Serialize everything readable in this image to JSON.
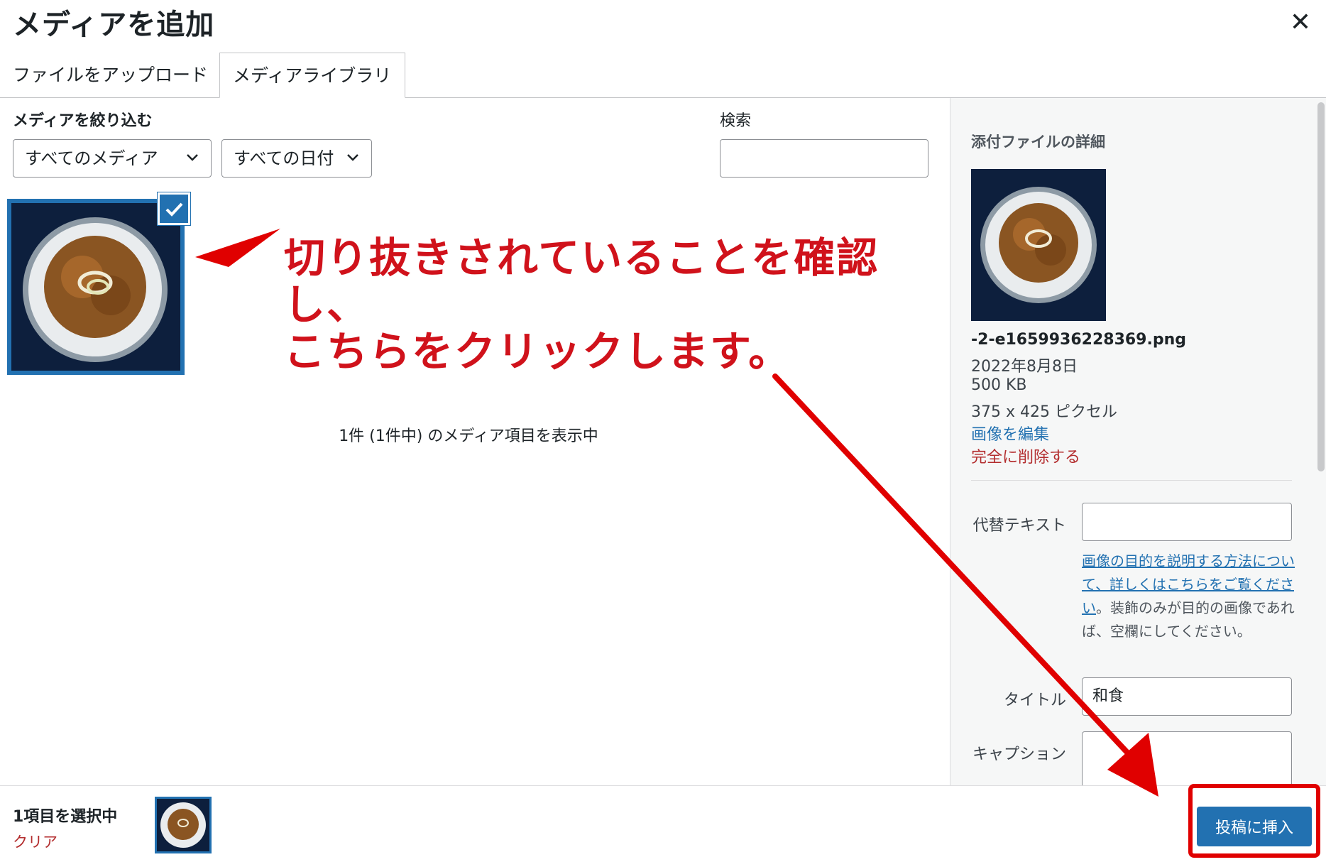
{
  "dialog": {
    "title": "メディアを追加",
    "close_icon": "close-icon"
  },
  "tabs": [
    {
      "label": "ファイルをアップロード",
      "active": false
    },
    {
      "label": "メディアライブラリ",
      "active": true
    }
  ],
  "toolbar": {
    "filter_label": "メディアを絞り込む",
    "media_type_selected": "すべてのメディア",
    "date_selected": "すべての日付",
    "search_label": "検索",
    "search_value": ""
  },
  "grid": {
    "items": [
      {
        "description": "natto rice bowl",
        "selected": true
      }
    ],
    "count_text": "1件 (1件中) のメディア項目を表示中"
  },
  "annotation": {
    "line1": "切り抜きされていることを確認し、",
    "line2": "こちらをクリックします。",
    "color": "#d0121b"
  },
  "attachment_details": {
    "heading": "添付ファイルの詳細",
    "filename": "-2-e1659936228369.png",
    "date": "2022年8月8日",
    "size": "500 KB",
    "dimensions": "375 x 425 ピクセル",
    "edit_link": "画像を編集",
    "delete_link": "完全に削除する",
    "alt_label": "代替テキスト",
    "alt_value": "",
    "alt_help_link": "画像の目的を説明する方法について、詳しくはこちらをご覧ください",
    "alt_help_text": "。装飾のみが目的の画像であれば、空欄にしてください。",
    "title_label": "タイトル",
    "title_value": "和食",
    "caption_label": "キャプション",
    "caption_value": ""
  },
  "footer": {
    "selected_count": "1項目を選択中",
    "clear_link": "クリア",
    "insert_button": "投稿に挿入"
  },
  "colors": {
    "primary": "#2271b1",
    "danger": "#b32d2e",
    "annotation_red": "#e00000"
  }
}
